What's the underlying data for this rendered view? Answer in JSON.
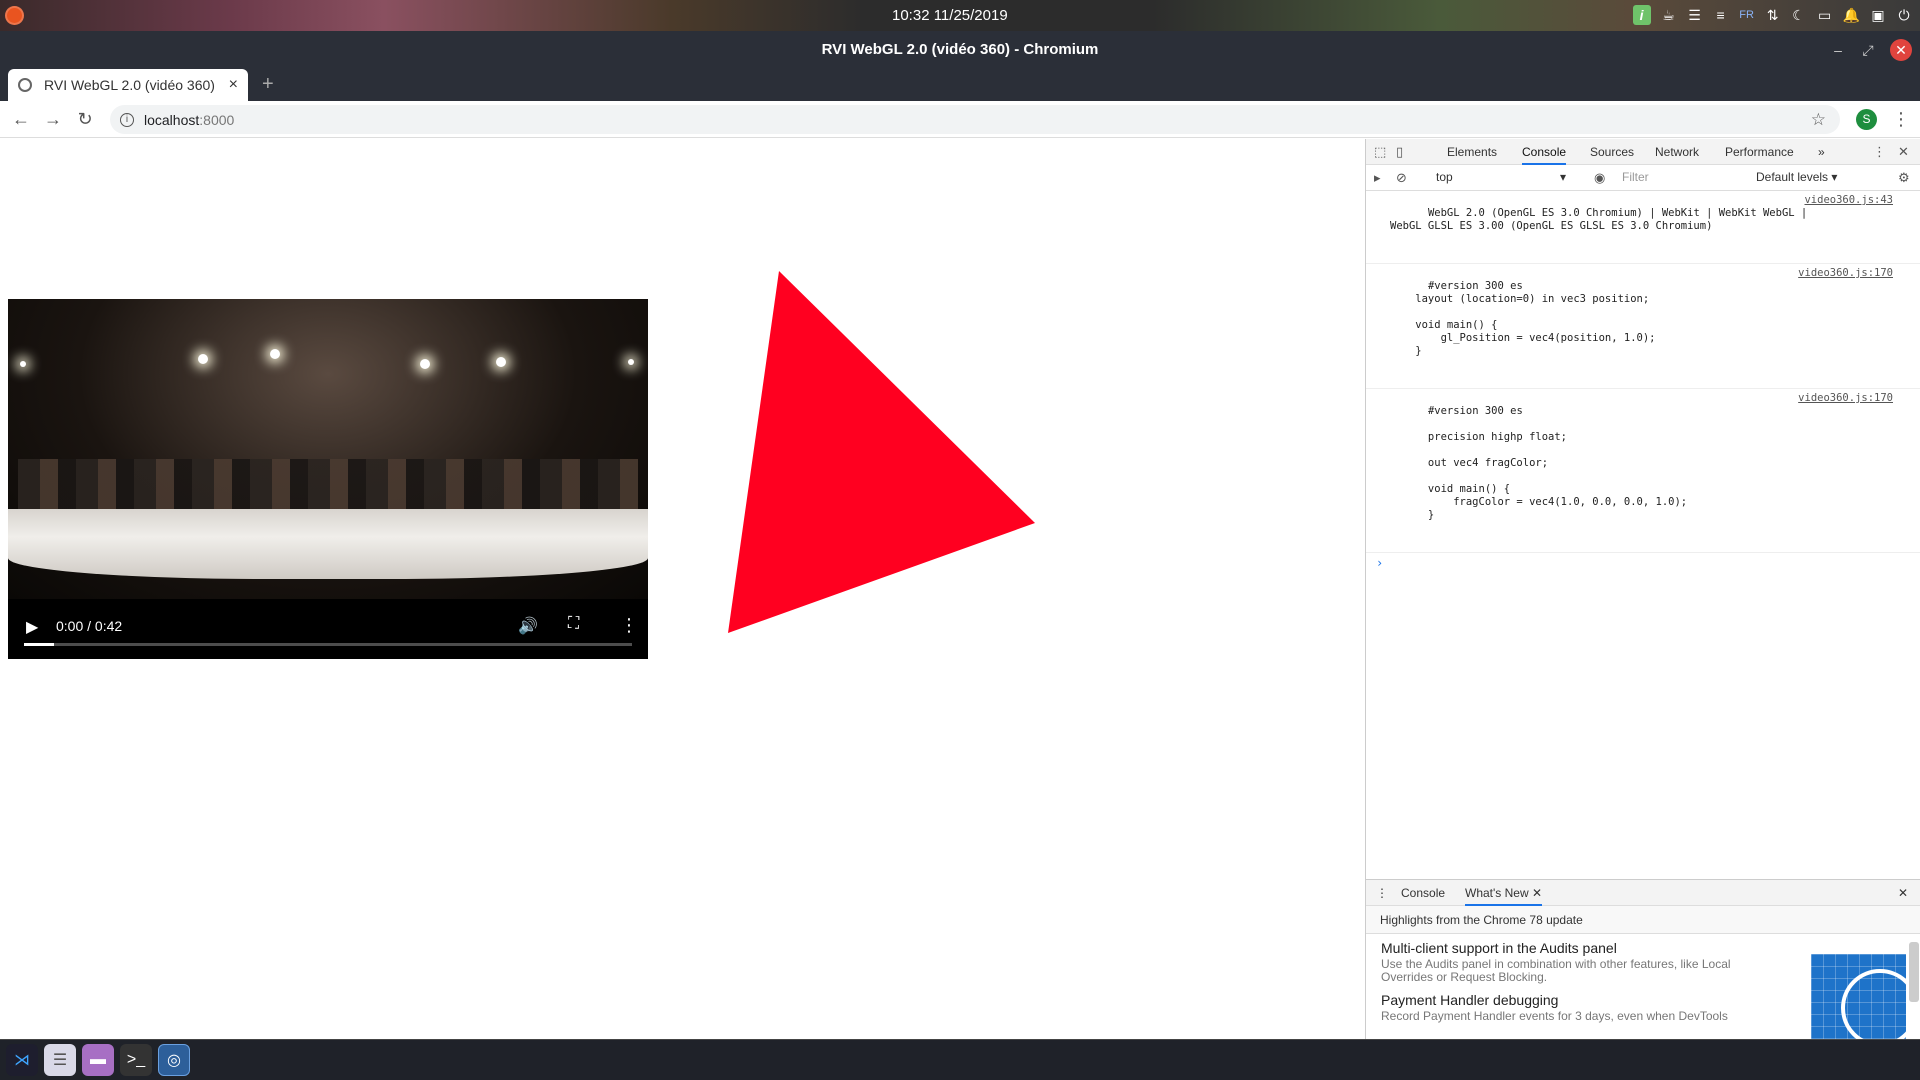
{
  "panel": {
    "clock": "10:32  11/25/2019",
    "tray": {
      "keyboard_layout": "FR"
    }
  },
  "window": {
    "title": "RVI WebGL 2.0 (vidéo 360) - Chromium"
  },
  "tab": {
    "title": "RVI WebGL 2.0 (vidéo 360)",
    "close": "×",
    "new_tab": "+"
  },
  "toolbar": {
    "url_host": "localhost",
    "url_port": ":8000",
    "profile_initial": "S"
  },
  "video": {
    "time": "0:00 / 0:42",
    "progress": 0.05
  },
  "triangle": {
    "color": "#ff0020"
  },
  "devtools": {
    "tabs": [
      "Elements",
      "Console",
      "Sources",
      "Network",
      "Performance"
    ],
    "active_tab": "Console",
    "more": "»",
    "context": "top",
    "filter_placeholder": "Filter",
    "levels": "Default levels ▾",
    "log": [
      {
        "text": "WebGL 2.0 (OpenGL ES 3.0 Chromium) | WebKit | WebKit WebGL |\nWebGL GLSL ES 3.00 (OpenGL ES GLSL ES 3.0 Chromium)",
        "source": "video360.js:43"
      },
      {
        "text": "#version 300 es\n    layout (location=0) in vec3 position;\n\n    void main() {\n        gl_Position = vec4(position, 1.0);\n    }",
        "source": "video360.js:170"
      },
      {
        "text": "#version 300 es\n\n      precision highp float;\n\n      out vec4 fragColor;\n\n      void main() {\n          fragColor = vec4(1.0, 0.0, 0.0, 1.0);\n      }",
        "source": "video360.js:170"
      }
    ],
    "prompt": "›",
    "drawer": {
      "tabs": [
        "Console",
        "What's New"
      ],
      "active": "What's New",
      "highlights": "Highlights from the Chrome 78 update",
      "news": [
        {
          "title": "Multi-client support in the Audits panel",
          "desc": "Use the Audits panel in combination with other features, like Local Overrides or Request Blocking."
        },
        {
          "title": "Payment Handler debugging",
          "desc": "Record Payment Handler events for 3 days, even when DevTools"
        }
      ]
    }
  }
}
